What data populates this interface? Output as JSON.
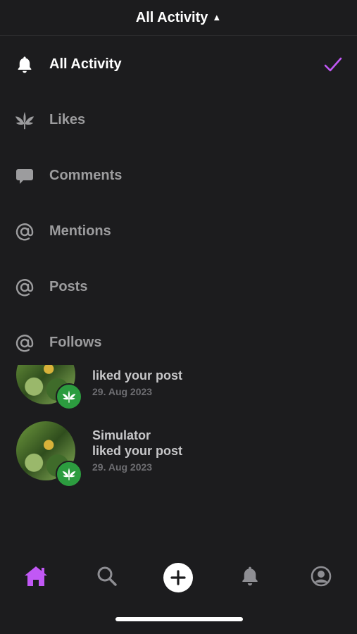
{
  "header": {
    "title": "All Activity",
    "caret": "▲"
  },
  "menu": {
    "items": [
      {
        "label": "All Activity",
        "icon": "bell-icon",
        "selected": true
      },
      {
        "label": "Likes",
        "icon": "leaf-icon",
        "selected": false
      },
      {
        "label": "Comments",
        "icon": "comment-icon",
        "selected": false
      },
      {
        "label": "Mentions",
        "icon": "at-icon",
        "selected": false
      },
      {
        "label": "Posts",
        "icon": "at-icon",
        "selected": false
      },
      {
        "label": "Follows",
        "icon": "at-icon",
        "selected": false
      }
    ],
    "check_color": "#c158f5"
  },
  "feed": {
    "items": [
      {
        "name": "",
        "action": "liked your post",
        "date": "29. Aug 2023"
      },
      {
        "name": "Simulator",
        "action": "liked your post",
        "date": "29. Aug 2023"
      }
    ]
  },
  "tabbar": {
    "accent": "#c158f5",
    "tabs": [
      "home-icon",
      "search-icon",
      "plus-icon",
      "bell-icon",
      "profile-icon"
    ]
  }
}
